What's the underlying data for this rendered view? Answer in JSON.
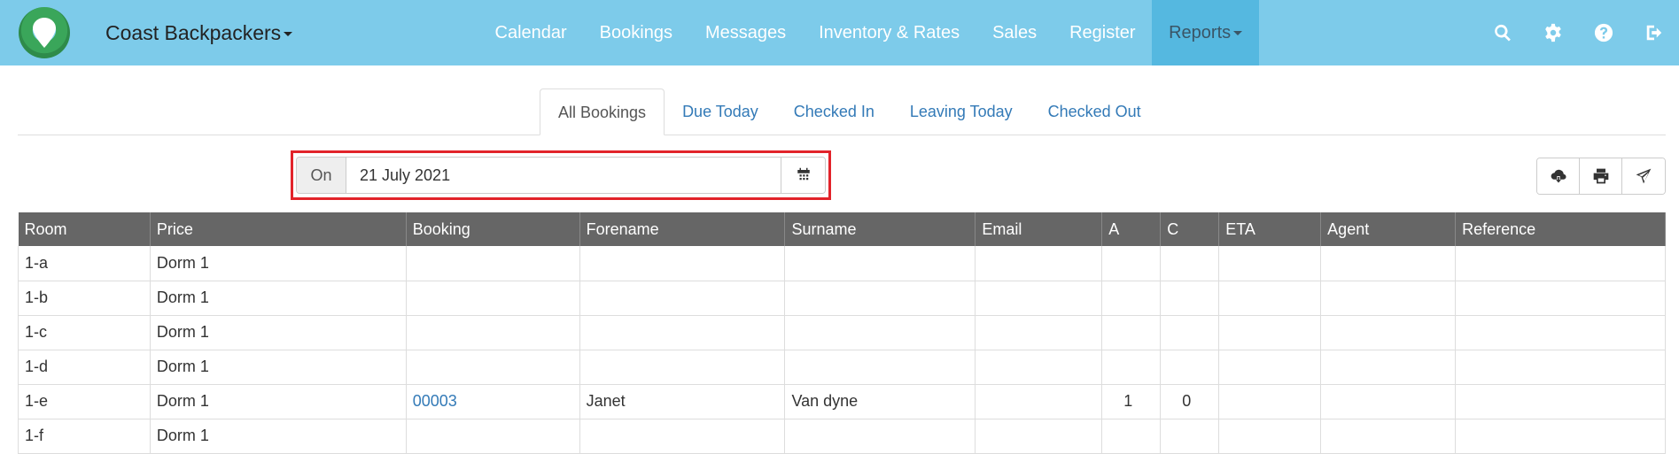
{
  "navbar": {
    "brand": "Coast Backpackers",
    "items": [
      {
        "label": "Calendar"
      },
      {
        "label": "Bookings"
      },
      {
        "label": "Messages"
      },
      {
        "label": "Inventory & Rates"
      },
      {
        "label": "Sales"
      },
      {
        "label": "Register"
      },
      {
        "label": "Reports"
      }
    ],
    "icons": [
      "search-icon",
      "gear-icon",
      "help-icon",
      "logout-icon"
    ]
  },
  "tabs": [
    {
      "label": "All Bookings",
      "active": true
    },
    {
      "label": "Due Today"
    },
    {
      "label": "Checked In"
    },
    {
      "label": "Leaving Today"
    },
    {
      "label": "Checked Out"
    }
  ],
  "filter": {
    "addon": "On",
    "date": "21 July 2021"
  },
  "actions": [
    "cloud-download-icon",
    "print-icon",
    "send-icon"
  ],
  "table": {
    "columns": [
      "Room",
      "Price",
      "Booking",
      "Forename",
      "Surname",
      "Email",
      "A",
      "C",
      "ETA",
      "Agent",
      "Reference"
    ],
    "rows": [
      {
        "room": "1-a",
        "price": "Dorm 1",
        "booking": "",
        "forename": "",
        "surname": "",
        "email": "",
        "a": "",
        "c": "",
        "eta": "",
        "agent": "",
        "reference": ""
      },
      {
        "room": "1-b",
        "price": "Dorm 1",
        "booking": "",
        "forename": "",
        "surname": "",
        "email": "",
        "a": "",
        "c": "",
        "eta": "",
        "agent": "",
        "reference": ""
      },
      {
        "room": "1-c",
        "price": "Dorm 1",
        "booking": "",
        "forename": "",
        "surname": "",
        "email": "",
        "a": "",
        "c": "",
        "eta": "",
        "agent": "",
        "reference": ""
      },
      {
        "room": "1-d",
        "price": "Dorm 1",
        "booking": "",
        "forename": "",
        "surname": "",
        "email": "",
        "a": "",
        "c": "",
        "eta": "",
        "agent": "",
        "reference": ""
      },
      {
        "room": "1-e",
        "price": "Dorm 1",
        "booking": "00003",
        "forename": "Janet",
        "surname": "Van dyne",
        "email": "",
        "a": "1",
        "c": "0",
        "eta": "",
        "agent": "",
        "reference": ""
      },
      {
        "room": "1-f",
        "price": "Dorm 1",
        "booking": "",
        "forename": "",
        "surname": "",
        "email": "",
        "a": "",
        "c": "",
        "eta": "",
        "agent": "",
        "reference": ""
      }
    ]
  },
  "colors": {
    "navbar": "#7dcbea",
    "navbar_active": "#55b8e0",
    "link": "#337ab7",
    "table_header": "#666666",
    "highlight": "#e2232a"
  }
}
